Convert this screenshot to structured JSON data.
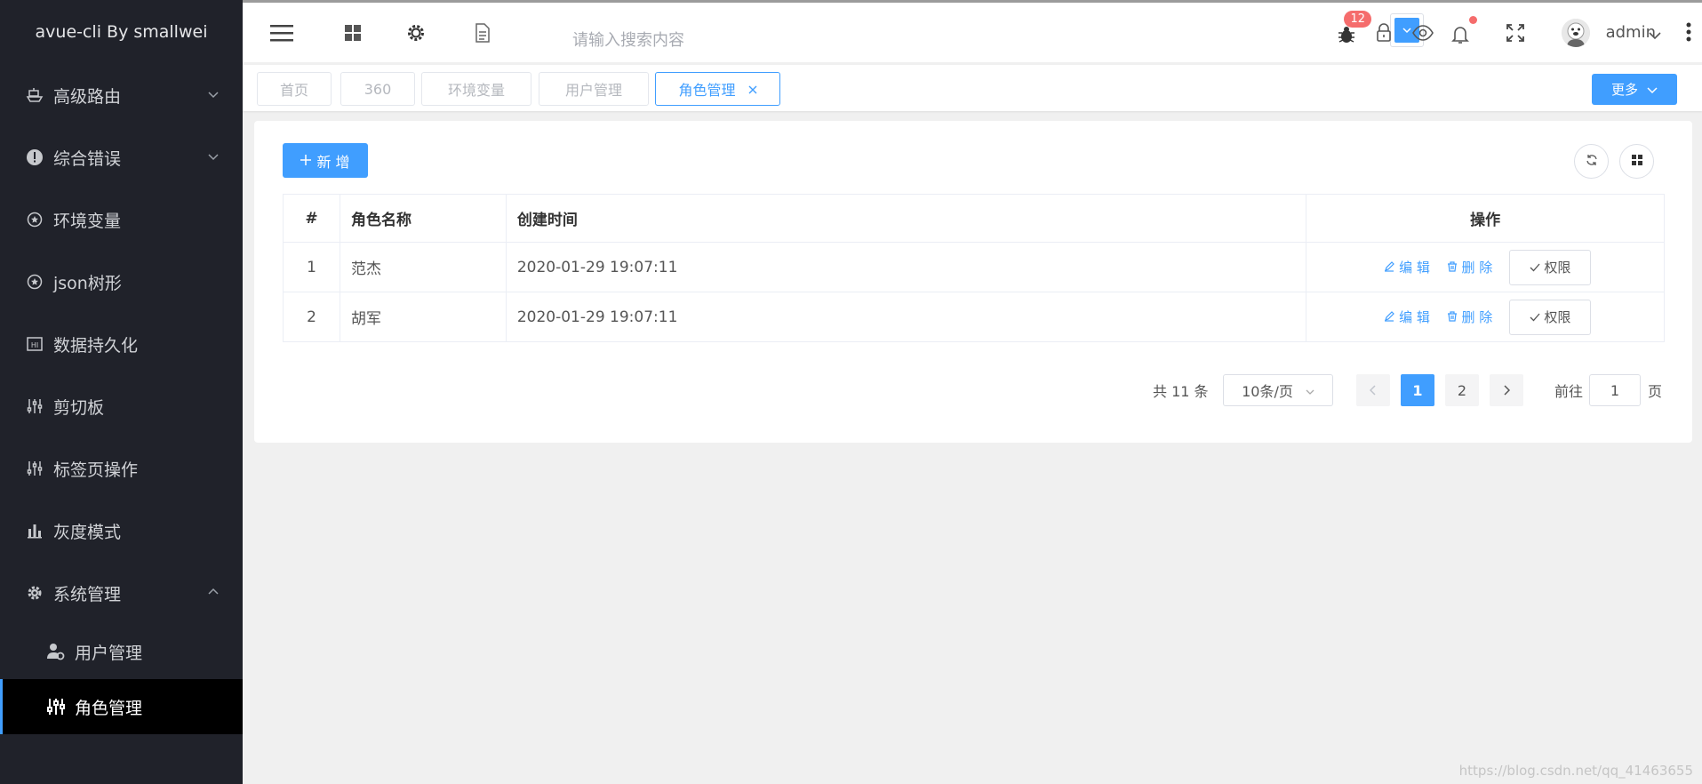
{
  "sidebar": {
    "logo": "avue-cli By smallwei",
    "items": [
      {
        "label": "高级路由",
        "icon": "ship-icon",
        "has_chevron": true
      },
      {
        "label": "综合错误",
        "icon": "warning-icon",
        "has_chevron": true
      },
      {
        "label": "环境变量",
        "icon": "star-circle-icon"
      },
      {
        "label": "json树形",
        "icon": "star-circle-icon"
      },
      {
        "label": "数据持久化",
        "icon": "hi-icon"
      },
      {
        "label": "剪切板",
        "icon": "sliders-icon"
      },
      {
        "label": "标签页操作",
        "icon": "sliders-icon"
      },
      {
        "label": "灰度模式",
        "icon": "bar-chart-icon"
      },
      {
        "label": "系统管理",
        "icon": "gear-icon",
        "expanded": true
      }
    ],
    "sub_items": [
      {
        "label": "用户管理",
        "icon": "user-gear-icon"
      },
      {
        "label": "角色管理",
        "icon": "role-icon",
        "active": true
      }
    ]
  },
  "header": {
    "search_placeholder": "请输入搜索内容",
    "bug_count": "12",
    "username": "admin"
  },
  "tags": {
    "items": [
      "首页",
      "360",
      "环境变量",
      "用户管理",
      "角色管理"
    ],
    "active": "角色管理",
    "more_label": "更多"
  },
  "toolbar": {
    "add_label": "新 增"
  },
  "table": {
    "columns": [
      "#",
      "角色名称",
      "创建时间",
      "操作"
    ],
    "rows": [
      {
        "index": "1",
        "name": "范杰",
        "created": "2020-01-29 19:07:11"
      },
      {
        "index": "2",
        "name": "胡军",
        "created": "2020-01-29 19:07:11"
      }
    ],
    "edit_label": "编 辑",
    "delete_label": "删 除",
    "perm_label": "权限"
  },
  "pagination": {
    "total_text": "共 11 条",
    "page_size": "10条/页",
    "pages": [
      "1",
      "2"
    ],
    "current": "1",
    "goto_label": "前往",
    "goto_value": "1",
    "page_unit": "页"
  },
  "watermark": "https://blog.csdn.net/qq_41463655",
  "colors": {
    "primary": "#409eff",
    "sidebar_bg": "#20222a",
    "badge": "#f56c6c"
  }
}
